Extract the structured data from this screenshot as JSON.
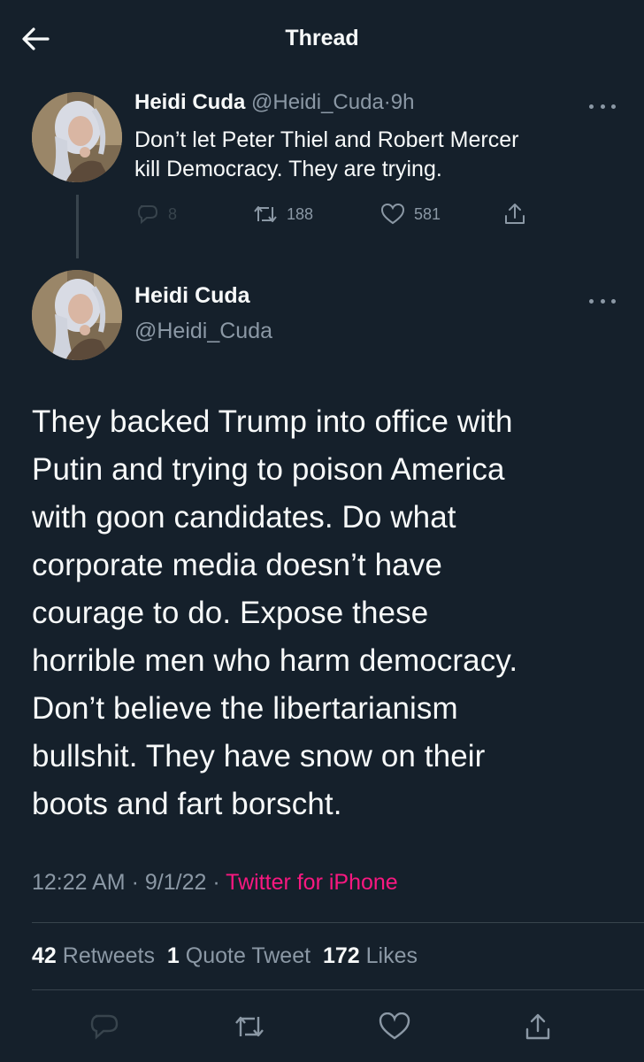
{
  "header": {
    "title": "Thread",
    "back_icon": "arrow-left-icon"
  },
  "parent_tweet": {
    "author_name": "Heidi Cuda",
    "author_handle": "@Heidi_Cuda",
    "separator": "·",
    "time_ago": "9h",
    "text_line1": "Don’t let Peter Thiel and Robert Mercer",
    "text_line2": "kill Democracy. They are trying.",
    "replies": "8",
    "retweets": "188",
    "likes": "581"
  },
  "main_tweet": {
    "author_name": "Heidi Cuda",
    "author_handle": "@Heidi_Cuda",
    "body_lines": [
      "They backed Trump into office with",
      "Putin and trying to poison America",
      "with goon candidates. Do what",
      "corporate media doesn’t have",
      "courage to do. Expose these",
      "horrible men who harm democracy.",
      "Don’t believe the libertarianism",
      "bullshit. They have snow on their",
      "boots and fart borscht."
    ],
    "time": "12:22 AM",
    "date": "9/1/22",
    "meta_separator": "·",
    "source": "Twitter for iPhone",
    "retweet_count": "42",
    "retweet_label": "Retweets",
    "quote_count": "1",
    "quote_label": "Quote Tweet",
    "like_count": "172",
    "like_label": "Likes"
  },
  "colors": {
    "background": "#15202b",
    "text": "#f7f9f9",
    "muted": "#8b98a5",
    "source_link": "#f91880",
    "divider": "#38444d"
  }
}
